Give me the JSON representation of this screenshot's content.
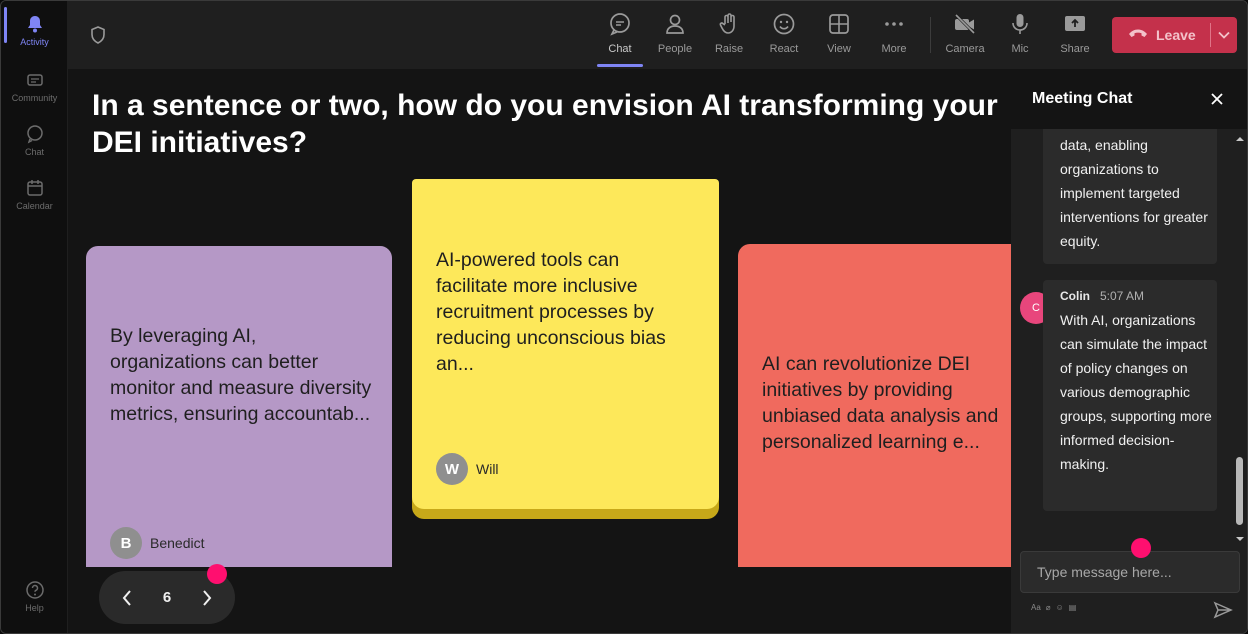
{
  "rail": {
    "items": [
      {
        "label": "Activity",
        "icon": "bell-icon",
        "active": true
      },
      {
        "label": "Community",
        "icon": "community-icon",
        "active": false
      },
      {
        "label": "Chat",
        "icon": "chat-icon",
        "active": false
      },
      {
        "label": "Calendar",
        "icon": "calendar-icon",
        "active": false
      }
    ],
    "help": {
      "label": "Help",
      "icon": "help-icon"
    }
  },
  "toolbar": {
    "buttons": [
      {
        "label": "Chat",
        "icon": "chat-icon"
      },
      {
        "label": "People",
        "icon": "people-icon"
      },
      {
        "label": "Raise",
        "icon": "raise-hand-icon"
      },
      {
        "label": "React",
        "icon": "react-icon"
      },
      {
        "label": "View",
        "icon": "view-grid-icon"
      },
      {
        "label": "More",
        "icon": "more-icon"
      },
      {
        "label": "Camera",
        "icon": "camera-off-icon"
      },
      {
        "label": "Mic",
        "icon": "mic-icon"
      },
      {
        "label": "Share",
        "icon": "share-icon"
      }
    ],
    "leave_label": "Leave",
    "accent_color": "#7f85f5",
    "leave_color": "#c4314b"
  },
  "stage": {
    "question": "In a sentence or two, how do you envision AI transforming your DEI initiatives?",
    "notes": [
      {
        "text": "By leveraging AI, organizations can better monitor and measure diversity metrics, ensuring accountab...",
        "author": "Benedict",
        "initial": "B",
        "color": "#b598c6"
      },
      {
        "text": "AI-powered tools can facilitate more inclusive recruitment processes by reducing unconscious bias an...",
        "author": "Will",
        "initial": "W",
        "color": "#fde85a"
      },
      {
        "text": "AI can revolutionize DEI initiatives by providing unbiased data analysis and personalized learning e...",
        "author": "",
        "initial": "",
        "color": "#f06a5e"
      }
    ],
    "pager": {
      "page": "6"
    }
  },
  "chat": {
    "title": "Meeting Chat",
    "messages": [
      {
        "author": "",
        "time": "",
        "text": "data, enabling organizations to implement targeted interventions for greater equity."
      },
      {
        "author": "Colin",
        "initial": "C",
        "time": "5:07 AM",
        "text": "With AI, organizations can simulate the impact of policy changes on various demographic groups, supporting more informed decision-making."
      }
    ],
    "input_placeholder": "Type message here..."
  }
}
